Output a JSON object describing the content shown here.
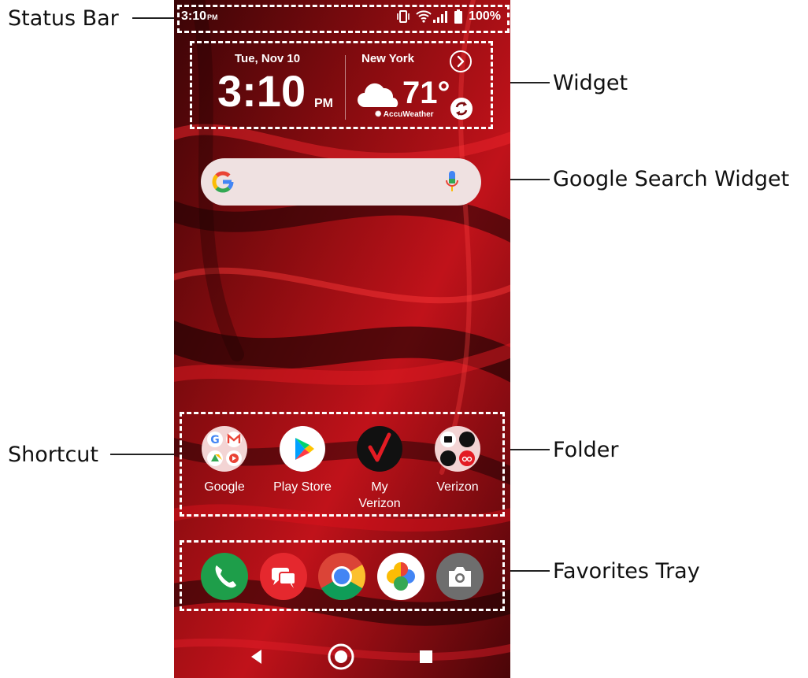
{
  "callouts": {
    "status_bar": "Status Bar",
    "widget": "Widget",
    "google_search_widget": "Google Search Widget",
    "shortcut": "Shortcut",
    "folder": "Folder",
    "favorites_tray": "Favorites Tray"
  },
  "status_bar": {
    "time": "3:10",
    "ampm": "PM",
    "battery": "100%",
    "icons": [
      "vibrate-icon",
      "wifi-icon",
      "signal-icon",
      "battery-icon"
    ]
  },
  "clock_widget": {
    "date": "Tue, Nov 10",
    "time": "3:10",
    "ampm": "PM",
    "city": "New York",
    "temperature": "71°",
    "provider": "AccuWeather",
    "icons": [
      "chevron-right-icon",
      "cloud-icon",
      "refresh-icon"
    ]
  },
  "search_widget": {
    "icons": [
      "google-g-icon",
      "microphone-icon"
    ]
  },
  "home_apps": [
    {
      "label": "Google",
      "icon": "google-folder-icon"
    },
    {
      "label": "Play Store",
      "icon": "play-store-icon"
    },
    {
      "label": "My Verizon",
      "label_line1": "My",
      "label_line2": "Verizon",
      "icon": "verizon-check-icon"
    },
    {
      "label": "Verizon",
      "icon": "verizon-folder-icon"
    }
  ],
  "favorites": [
    {
      "icon": "phone-icon"
    },
    {
      "icon": "messages-icon"
    },
    {
      "icon": "chrome-icon"
    },
    {
      "icon": "photos-icon"
    },
    {
      "icon": "camera-icon"
    }
  ],
  "nav_bar": {
    "icons": [
      "back-icon",
      "home-icon",
      "recents-icon"
    ]
  },
  "colors": {
    "wallpaper_base": "#5a0608",
    "wallpaper_red": "#d01018",
    "phone_green": "#1e9e4a",
    "messages_red": "#e5282e",
    "camera_gray": "#6e6e6e"
  }
}
